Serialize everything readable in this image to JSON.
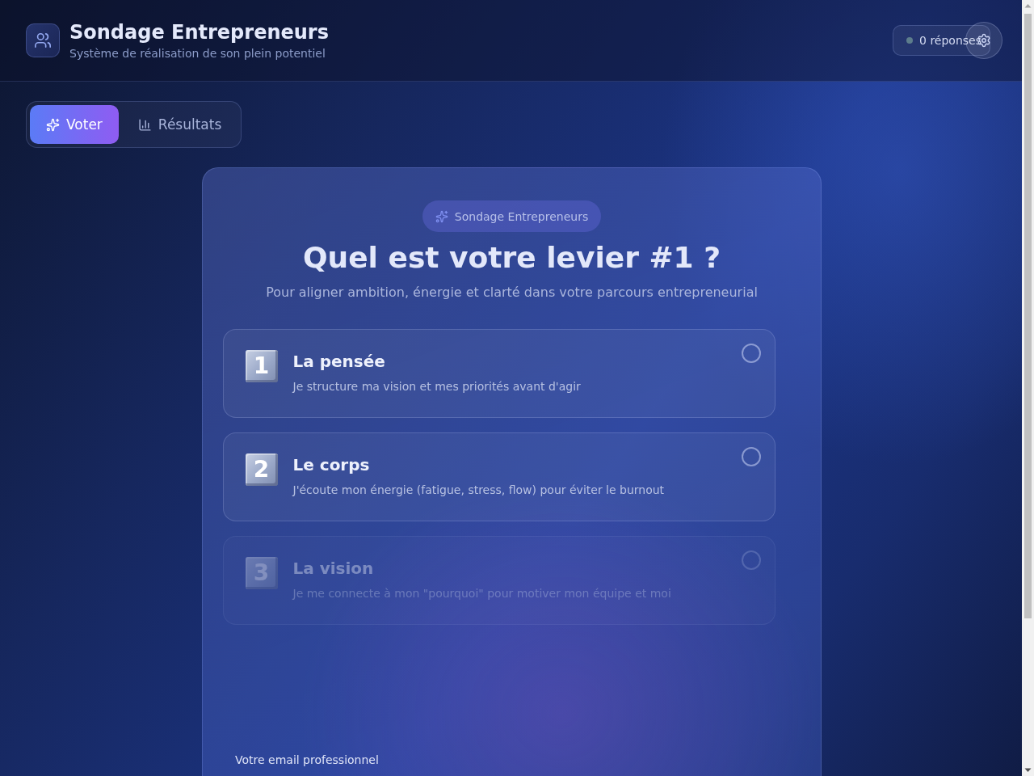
{
  "header": {
    "title": "Sondage Entrepreneurs",
    "subtitle": "Système de réalisation de son plein potentiel",
    "response_count": "0 réponses"
  },
  "tabs": [
    {
      "label": "Voter",
      "selected": true
    },
    {
      "label": "Résultats",
      "selected": false
    }
  ],
  "survey": {
    "badge": "Sondage Entrepreneurs",
    "question": "Quel est votre levier #1 ?",
    "intro": "Pour aligner ambition, énergie et clarté dans votre parcours entrepreneurial",
    "options": [
      {
        "number": "1",
        "title": "La pensée",
        "description": "Je structure ma vision et mes priorités avant d'agir",
        "selected": false,
        "dimmed": false
      },
      {
        "number": "2",
        "title": "Le corps",
        "description": "J'écoute mon énergie (fatigue, stress, flow) pour éviter le burnout",
        "selected": false,
        "dimmed": false
      },
      {
        "number": "3",
        "title": "La vision",
        "description": "Je me connecte à mon \"pourquoi\" pour motiver mon équipe et moi",
        "selected": false,
        "dimmed": true
      }
    ],
    "email_label": "Votre email professionnel"
  }
}
